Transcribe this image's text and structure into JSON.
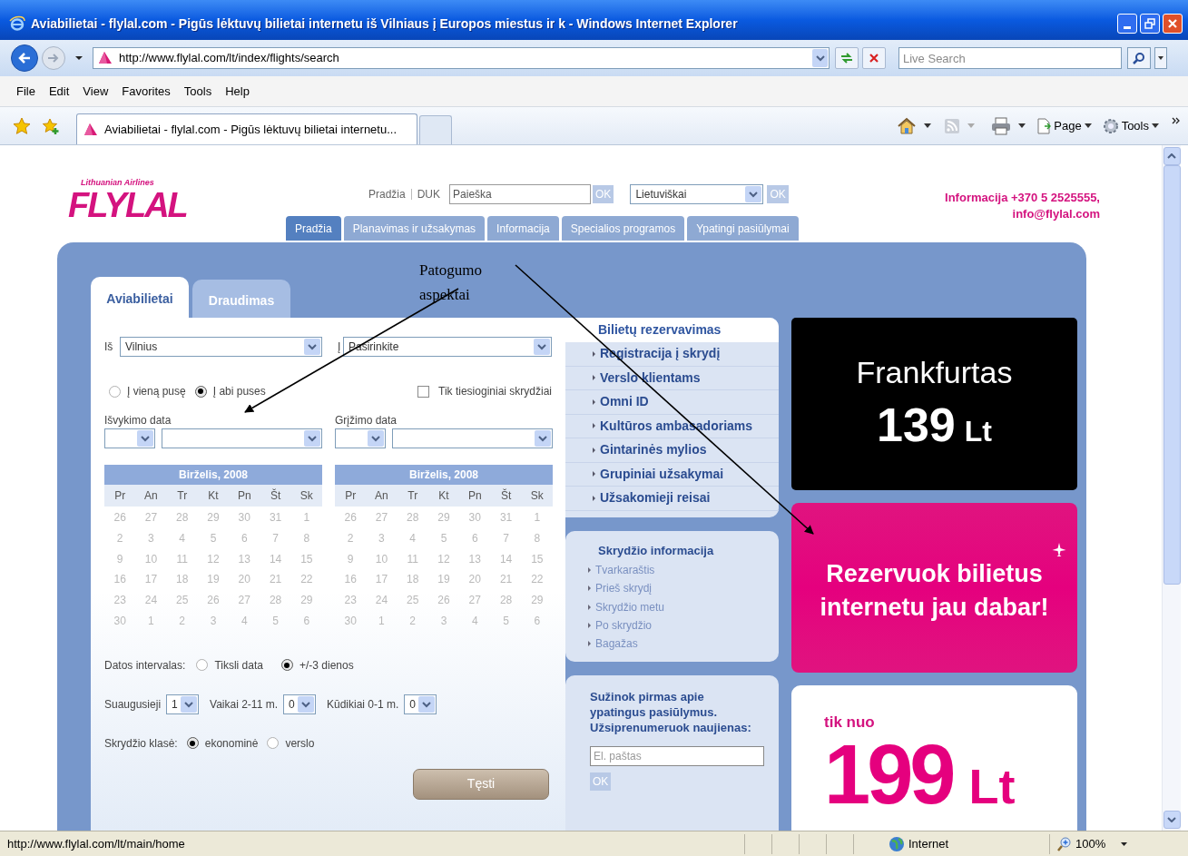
{
  "window": {
    "title": "Aviabilietai - flylal.com - Pigūs lėktuvų bilietai internetu iš Vilniaus į Europos miestus ir k - Windows Internet Explorer"
  },
  "address_bar": {
    "url": "http://www.flylal.com/lt/index/flights/search"
  },
  "search_box": {
    "placeholder": "Live Search"
  },
  "menu": [
    "File",
    "Edit",
    "View",
    "Favorites",
    "Tools",
    "Help"
  ],
  "browser_tabs": [
    {
      "label": "Aviabilietai - flylal.com - Pigūs lėktuvų bilietai internetu...",
      "selected": true
    }
  ],
  "command_bar": [
    "Page",
    "Tools"
  ],
  "site": {
    "logo": {
      "name": "FLYLAL",
      "tagline": "Lithuanian Airlines"
    },
    "top_links": [
      "Pradžia",
      "DUK"
    ],
    "search": {
      "value": "Paieška",
      "button": "OK"
    },
    "language": {
      "value": "Lietuviškai",
      "button": "OK"
    },
    "contact": [
      "Informacija +370 5 2525555,",
      "info@flylal.com"
    ],
    "nav_tabs": [
      {
        "label": "Pradžia",
        "selected": true
      },
      {
        "label": "Planavimas ir užsakymas",
        "selected": false
      },
      {
        "label": "Informacija",
        "selected": false
      },
      {
        "label": "Specialios programos",
        "selected": false
      },
      {
        "label": "Ypatingi pasiūlymai",
        "selected": false
      }
    ]
  },
  "booking": {
    "tabs": [
      {
        "label": "Aviabilietai",
        "selected": true
      },
      {
        "label": "Draudimas",
        "selected": false
      }
    ],
    "from": {
      "label": "Iš",
      "value": "Vilnius"
    },
    "to": {
      "label": "Į",
      "value": "Pasirinkite"
    },
    "trip_type": [
      {
        "label": "Į vieną pusę",
        "selected": false
      },
      {
        "label": "Į abi puses",
        "selected": true
      }
    ],
    "direct_only": {
      "label": "Tik tiesioginiai skrydžiai",
      "checked": false
    },
    "dates": [
      {
        "label": "Išvykimo data",
        "calendar": {
          "title": "Birželis, 2008",
          "weekdays": [
            "Pr",
            "An",
            "Tr",
            "Kt",
            "Pn",
            "Št",
            "Sk"
          ],
          "weeks": [
            [
              "26",
              "27",
              "28",
              "29",
              "30",
              "31",
              "1"
            ],
            [
              "2",
              "3",
              "4",
              "5",
              "6",
              "7",
              "8"
            ],
            [
              "9",
              "10",
              "11",
              "12",
              "13",
              "14",
              "15"
            ],
            [
              "16",
              "17",
              "18",
              "19",
              "20",
              "21",
              "22"
            ],
            [
              "23",
              "24",
              "25",
              "26",
              "27",
              "28",
              "29"
            ],
            [
              "30",
              "1",
              "2",
              "3",
              "4",
              "5",
              "6"
            ]
          ]
        }
      },
      {
        "label": "Grįžimo data",
        "calendar": {
          "title": "Birželis, 2008",
          "weekdays": [
            "Pr",
            "An",
            "Tr",
            "Kt",
            "Pn",
            "Št",
            "Sk"
          ],
          "weeks": [
            [
              "26",
              "27",
              "28",
              "29",
              "30",
              "31",
              "1"
            ],
            [
              "2",
              "3",
              "4",
              "5",
              "6",
              "7",
              "8"
            ],
            [
              "9",
              "10",
              "11",
              "12",
              "13",
              "14",
              "15"
            ],
            [
              "16",
              "17",
              "18",
              "19",
              "20",
              "21",
              "22"
            ],
            [
              "23",
              "24",
              "25",
              "26",
              "27",
              "28",
              "29"
            ],
            [
              "30",
              "1",
              "2",
              "3",
              "4",
              "5",
              "6"
            ]
          ]
        }
      }
    ],
    "date_interval": {
      "label": "Datos intervalas:",
      "options": [
        {
          "label": "Tiksli data",
          "selected": false
        },
        {
          "label": "+/-3 dienos",
          "selected": true
        }
      ]
    },
    "passengers": [
      {
        "label": "Suaugusieji",
        "value": "1"
      },
      {
        "label": "Vaikai 2-11 m.",
        "value": "0"
      },
      {
        "label": "Kūdikiai 0-1 m.",
        "value": "0"
      }
    ],
    "travel_class": {
      "label": "Skrydžio klasė:",
      "options": [
        {
          "label": "ekonominė",
          "selected": true
        },
        {
          "label": "verslo",
          "selected": false
        }
      ]
    },
    "submit": "Tęsti"
  },
  "side_menu": {
    "title": "Bilietų rezervavimas",
    "items": [
      "Registracija į skrydį",
      "Verslo klientams",
      "Omni ID",
      "Kultūros ambasadoriams",
      "Gintarinės mylios",
      "Grupiniai užsakymai",
      "Užsakomieji reisai"
    ]
  },
  "flight_info": {
    "title": "Skrydžio informacija",
    "items": [
      "Tvarkaraštis",
      "Prieš skrydį",
      "Skrydžio metu",
      "Po skrydžio",
      "Bagažas"
    ]
  },
  "newsletter": {
    "text": "Sužinok pirmas apie ypatingus pasiūlymus. Užsiprenumeruok naujienas:",
    "placeholder": "El. paštas",
    "button": "OK"
  },
  "promos": [
    {
      "kind": "destination",
      "city": "Frankfurtas",
      "price": "139",
      "currency": "Lt"
    },
    {
      "kind": "cta",
      "text": "Rezervuok bilietus internetu jau dabar!"
    },
    {
      "kind": "price",
      "prefix": "tik nuo",
      "price": "199",
      "currency": "Lt"
    }
  ],
  "annotation": {
    "text": "Patogumo aspektai"
  },
  "status_bar": {
    "url": "http://www.flylal.com/lt/main/home",
    "zone": "Internet",
    "zoom": "100%"
  }
}
